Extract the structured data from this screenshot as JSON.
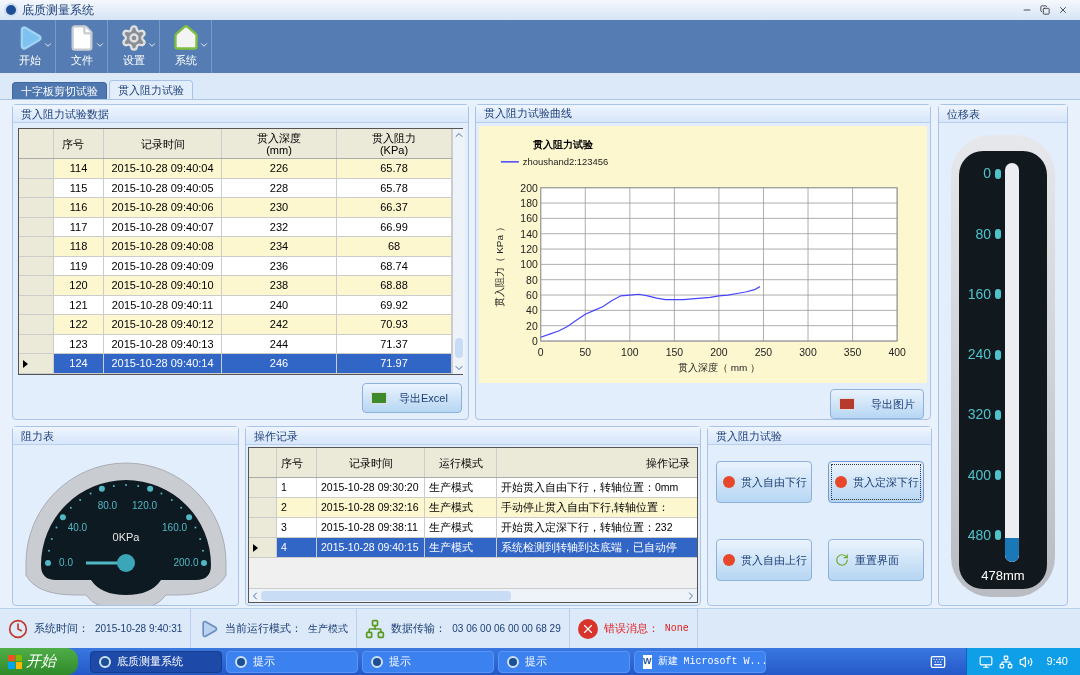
{
  "window": {
    "title": "底质测量系统"
  },
  "toolbar": [
    {
      "label": "开始",
      "kind": "play"
    },
    {
      "label": "文件",
      "kind": "file"
    },
    {
      "label": "设置",
      "kind": "gear"
    },
    {
      "label": "系统",
      "kind": "home"
    }
  ],
  "tabs": [
    {
      "label": "十字板剪切试验",
      "selected": false
    },
    {
      "label": "贯入阻力试验",
      "selected": true
    }
  ],
  "data_panel": {
    "title": "贯入阻力试验数据",
    "columns": [
      {
        "label": "序号"
      },
      {
        "label": "记录时间"
      },
      {
        "label": "贯入深度",
        "unit": "(mm)"
      },
      {
        "label": "贯入阻力",
        "unit": "(KPa)"
      }
    ],
    "rows": [
      {
        "cells": [
          "114",
          "2015-10-28 09:40:04",
          "226",
          "65.78"
        ],
        "selected": false
      },
      {
        "cells": [
          "115",
          "2015-10-28 09:40:05",
          "228",
          "65.78"
        ],
        "selected": false
      },
      {
        "cells": [
          "116",
          "2015-10-28 09:40:06",
          "230",
          "66.37"
        ],
        "selected": false
      },
      {
        "cells": [
          "117",
          "2015-10-28 09:40:07",
          "232",
          "66.99"
        ],
        "selected": false
      },
      {
        "cells": [
          "118",
          "2015-10-28 09:40:08",
          "234",
          "68"
        ],
        "selected": false
      },
      {
        "cells": [
          "119",
          "2015-10-28 09:40:09",
          "236",
          "68.74"
        ],
        "selected": false
      },
      {
        "cells": [
          "120",
          "2015-10-28 09:40:10",
          "238",
          "68.88"
        ],
        "selected": false
      },
      {
        "cells": [
          "121",
          "2015-10-28 09:40:11",
          "240",
          "69.92"
        ],
        "selected": false
      },
      {
        "cells": [
          "122",
          "2015-10-28 09:40:12",
          "242",
          "70.93"
        ],
        "selected": false
      },
      {
        "cells": [
          "123",
          "2015-10-28 09:40:13",
          "244",
          "71.37"
        ],
        "selected": false
      },
      {
        "cells": [
          "124",
          "2015-10-28 09:40:14",
          "246",
          "71.97"
        ],
        "selected": true
      }
    ],
    "export_button": "导出Excel"
  },
  "chart_panel": {
    "title": "贯入阻力试验曲线",
    "export_button": "导出图片",
    "chart_data": {
      "type": "line",
      "grid": true,
      "title": "贯入阻力试验",
      "xlabel": "贯入深度（ mm ）",
      "ylabel": "贯入阻力（ KPa ）",
      "x": [
        0,
        10,
        20,
        30,
        40,
        50,
        60,
        70,
        80,
        90,
        100,
        110,
        120,
        130,
        140,
        150,
        160,
        170,
        180,
        190,
        200,
        210,
        220,
        230,
        240,
        246
      ],
      "series": [
        {
          "name": "zhoushand2:123456",
          "color": "#4444ff",
          "values": [
            5,
            9,
            13,
            19,
            27,
            35,
            40,
            45,
            53,
            59,
            60,
            61,
            59,
            56,
            54,
            54,
            54,
            55,
            56,
            57,
            59,
            60,
            62,
            64,
            67,
            71
          ]
        }
      ],
      "xlim": [
        0,
        400
      ],
      "ylim": [
        0,
        200
      ],
      "xticks": [
        0,
        50,
        100,
        150,
        200,
        250,
        300,
        350,
        400
      ],
      "yticks": [
        0,
        20,
        40,
        60,
        80,
        100,
        120,
        140,
        160,
        180,
        200
      ]
    }
  },
  "displacement_panel": {
    "title": "位移表",
    "scale": [
      "0",
      "80",
      "160",
      "240",
      "320",
      "400",
      "480"
    ],
    "reading": "478mm",
    "level": 0.06
  },
  "gauge_panel": {
    "title": "阻力表",
    "scale": [
      "0.0",
      "40.0",
      "80.0",
      "120.0",
      "160.0",
      "200.0"
    ],
    "reading": "0KPa"
  },
  "log_panel": {
    "title": "操作记录",
    "columns": [
      {
        "label": "序号"
      },
      {
        "label": "记录时间"
      },
      {
        "label": "运行模式"
      },
      {
        "label": "操作记录"
      }
    ],
    "rows": [
      {
        "cells": [
          "1",
          "2015-10-28 09:30:20",
          "生产模式",
          "开始贯入自由下行，转轴位置：0mm"
        ],
        "selected": false
      },
      {
        "cells": [
          "2",
          "2015-10-28 09:32:16",
          "生产模式",
          "手动停止贯入自由下行,转轴位置："
        ],
        "selected": false
      },
      {
        "cells": [
          "3",
          "2015-10-28 09:38:11",
          "生产模式",
          "开始贯入定深下行，转轴位置：232"
        ],
        "selected": false
      },
      {
        "cells": [
          "4",
          "2015-10-28 09:40:15",
          "生产模式",
          "系统检测到转轴到达底端，已自动停"
        ],
        "selected": true
      }
    ]
  },
  "control_panel": {
    "title": "贯入阻力试验",
    "buttons": [
      {
        "label": "贯入自由下行",
        "kind": "dot",
        "focused": false
      },
      {
        "label": "贯入定深下行",
        "kind": "dot",
        "focused": true
      },
      {
        "label": "贯入自由上行",
        "kind": "dot",
        "focused": false
      },
      {
        "label": "重置界面",
        "kind": "reset",
        "focused": false
      }
    ]
  },
  "status_bar": [
    {
      "kind": "clock",
      "label": "系统时间：",
      "value": "2015-10-28 9:40:31"
    },
    {
      "kind": "mode",
      "label": "当前运行模式：",
      "value": "生产模式"
    },
    {
      "kind": "network",
      "label": "数据传输：",
      "value": "03 06 00 06 00 00 68 29"
    },
    {
      "kind": "error",
      "label": "错误消息：",
      "value": "None"
    }
  ],
  "taskbar": {
    "start": "开始",
    "items": [
      {
        "label": "底质测量系统",
        "kind": "app",
        "selected": true
      },
      {
        "label": "提示",
        "kind": "app",
        "selected": false
      },
      {
        "label": "提示",
        "kind": "app",
        "selected": false
      },
      {
        "label": "提示",
        "kind": "app",
        "selected": false
      },
      {
        "label": "新建 Microsoft W...",
        "kind": "word",
        "icon_letter": "W",
        "selected": false
      }
    ],
    "time": "9:40"
  }
}
